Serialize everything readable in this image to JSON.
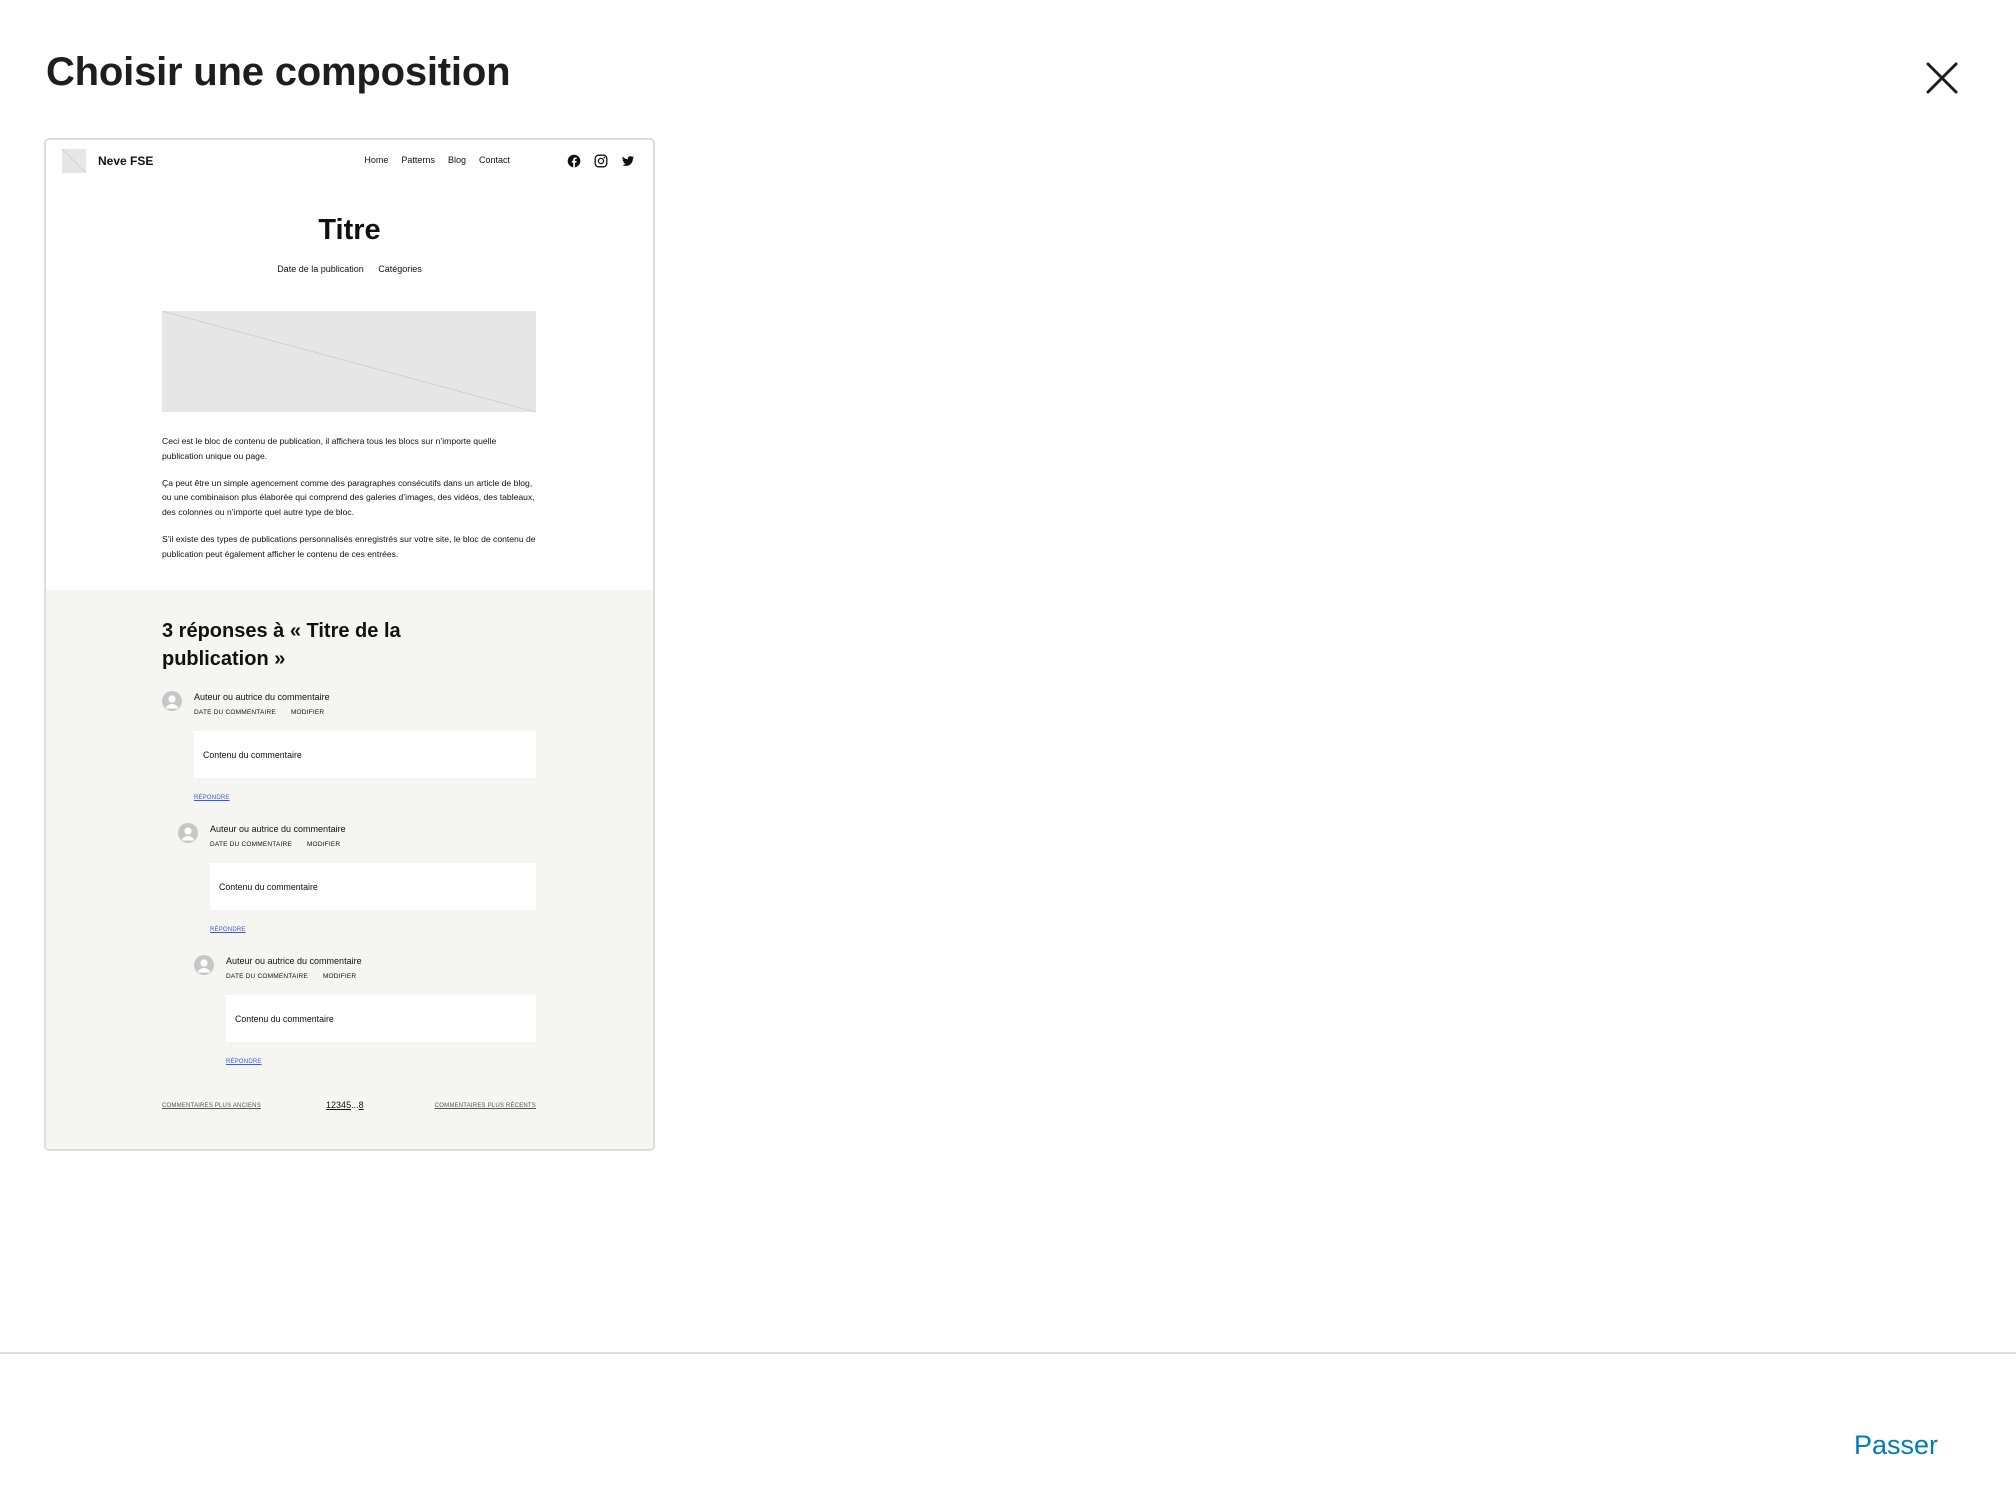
{
  "modal": {
    "title": "Choisir une composition",
    "close_icon": "close-icon",
    "skip_label": "Passer"
  },
  "pattern": {
    "site_title": "Neve FSE",
    "nav": [
      "Home",
      "Patterns",
      "Blog",
      "Contact"
    ],
    "social_icons": [
      "facebook-icon",
      "instagram-icon",
      "twitter-icon"
    ],
    "post_title": "Titre",
    "post_date": "Date de la publication",
    "post_categories": "Catégories",
    "paragraphs": [
      "Ceci est le bloc de contenu de publication, il affichera tous les blocs sur n’importe quelle publication unique ou page.",
      "Ça peut être un simple agencement comme des paragraphes consécutifs dans un article de blog, ou une combinaison plus élaborée qui comprend des galeries d’images, des vidéos, des tableaux, des colonnes ou n’importe quel autre type de bloc.",
      "S’il existe des types de publications personnalisés enregistrés sur votre site, le bloc de contenu de publication peut également afficher le contenu de ces entrées."
    ],
    "comments_title": "3 réponses à « Titre de la publication »",
    "comments": [
      {
        "author": "Auteur ou autrice du commentaire",
        "date": "DATE DU COMMENTAIRE",
        "edit": "MODIFIER",
        "content": "Contenu du commentaire",
        "reply": "RÉPONDRE"
      },
      {
        "author": "Auteur ou autrice du commentaire",
        "date": "DATE DU COMMENTAIRE",
        "edit": "MODIFIER",
        "content": "Contenu du commentaire",
        "reply": "RÉPONDRE"
      },
      {
        "author": "Auteur ou autrice du commentaire",
        "date": "DATE DU COMMENTAIRE",
        "edit": "MODIFIER",
        "content": "Contenu du commentaire",
        "reply": "RÉPONDRE"
      }
    ],
    "pagination": {
      "older": "COMMENTAIRES PLUS ANCIENS",
      "numbers": [
        "1",
        "2",
        "3",
        "4",
        "5",
        "...",
        "8"
      ],
      "newer": "COMMENTAIRES PLUS RÉCENTS"
    }
  },
  "colors": {
    "accent": "#007cba",
    "link": "#3858e9",
    "comments_bg": "#f5f5f2",
    "placeholder": "#e6e6e6"
  }
}
